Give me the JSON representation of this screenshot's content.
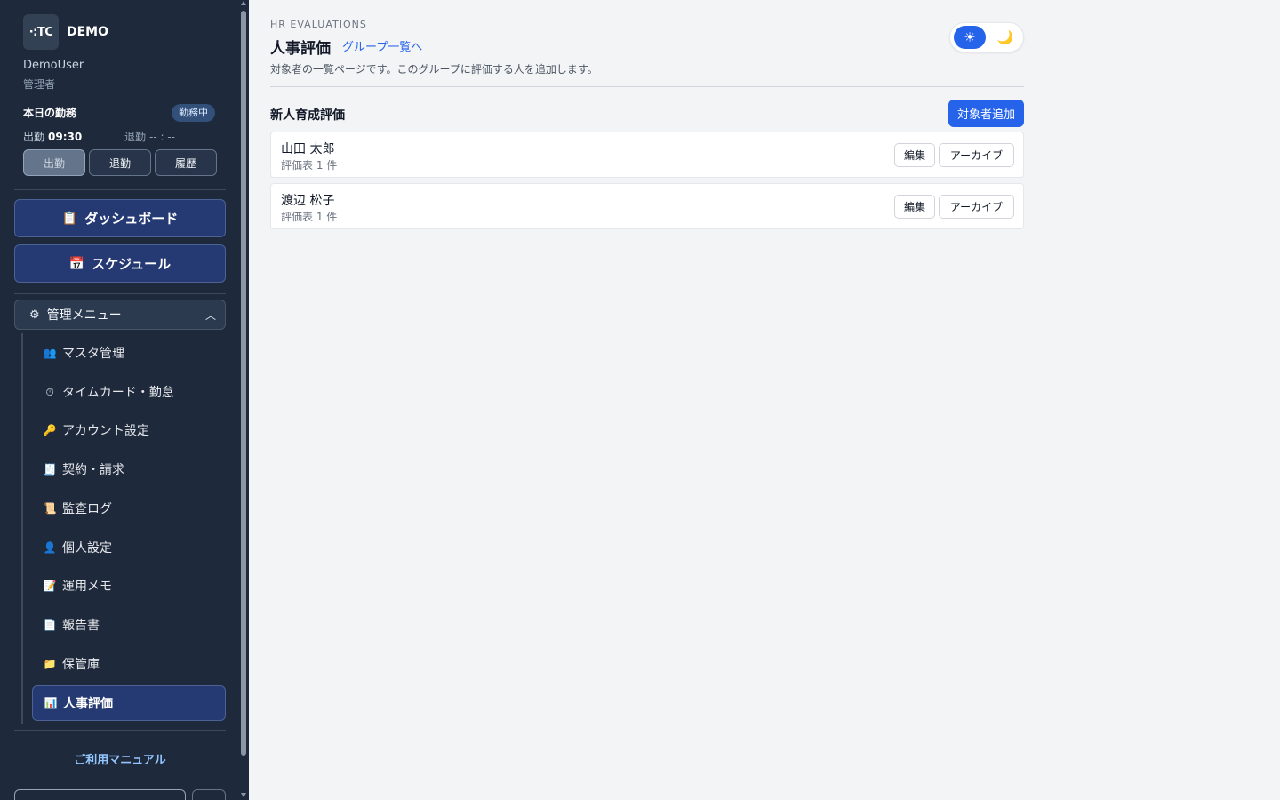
{
  "sidebar": {
    "brand": {
      "logo_text": "·:TC",
      "name": "DEMO"
    },
    "user": {
      "name": "DemoUser",
      "role": "管理者"
    },
    "attendance": {
      "title": "本日の勤務",
      "status": "勤務中",
      "clock_in_label": "出勤",
      "clock_in_time": "09:30",
      "clock_out_label": "退勤",
      "clock_out_time": "-- : --",
      "buttons": {
        "clock_in": "出勤",
        "clock_out": "退勤",
        "history": "履歴"
      }
    },
    "primary_nav": [
      {
        "label": "ダッシュボード",
        "icon": "clipboard-icon"
      },
      {
        "label": "スケジュール",
        "icon": "calendar-icon"
      }
    ],
    "admin_menu": {
      "label": "管理メニュー",
      "expanded": true,
      "items": [
        {
          "label": "マスタ管理",
          "icon": "users-icon"
        },
        {
          "label": "タイムカード・勤怠",
          "icon": "stopwatch-icon"
        },
        {
          "label": "アカウント設定",
          "icon": "key-icon"
        },
        {
          "label": "契約・請求",
          "icon": "receipt-icon"
        },
        {
          "label": "監査ログ",
          "icon": "scroll-icon"
        },
        {
          "label": "個人設定",
          "icon": "person-icon"
        },
        {
          "label": "運用メモ",
          "icon": "memo-icon"
        },
        {
          "label": "報告書",
          "icon": "document-icon"
        },
        {
          "label": "保管庫",
          "icon": "folder-icon"
        },
        {
          "label": "人事評価",
          "icon": "bar-chart-icon",
          "active": true
        }
      ]
    },
    "manual_link": "ご利用マニュアル"
  },
  "header": {
    "eyebrow": "HR EVALUATIONS",
    "title": "人事評価",
    "group_link": "グループ一覧へ",
    "description": "対象者の一覧ページです。このグループに評価する人を追加します。",
    "theme": {
      "selected": "light"
    }
  },
  "group": {
    "title": "新人育成評価",
    "add_button": "対象者追加",
    "members": [
      {
        "name": "山田 太郎",
        "meta": "評価表 1 件",
        "edit": "編集",
        "archive": "アーカイブ"
      },
      {
        "name": "渡辺 松子",
        "meta": "評価表 1 件",
        "edit": "編集",
        "archive": "アーカイブ"
      }
    ]
  },
  "colors": {
    "sidebar_bg": "#1e293b",
    "accent": "#2563eb",
    "nav_active": "#253a73",
    "page_bg": "#f3f4f6"
  }
}
